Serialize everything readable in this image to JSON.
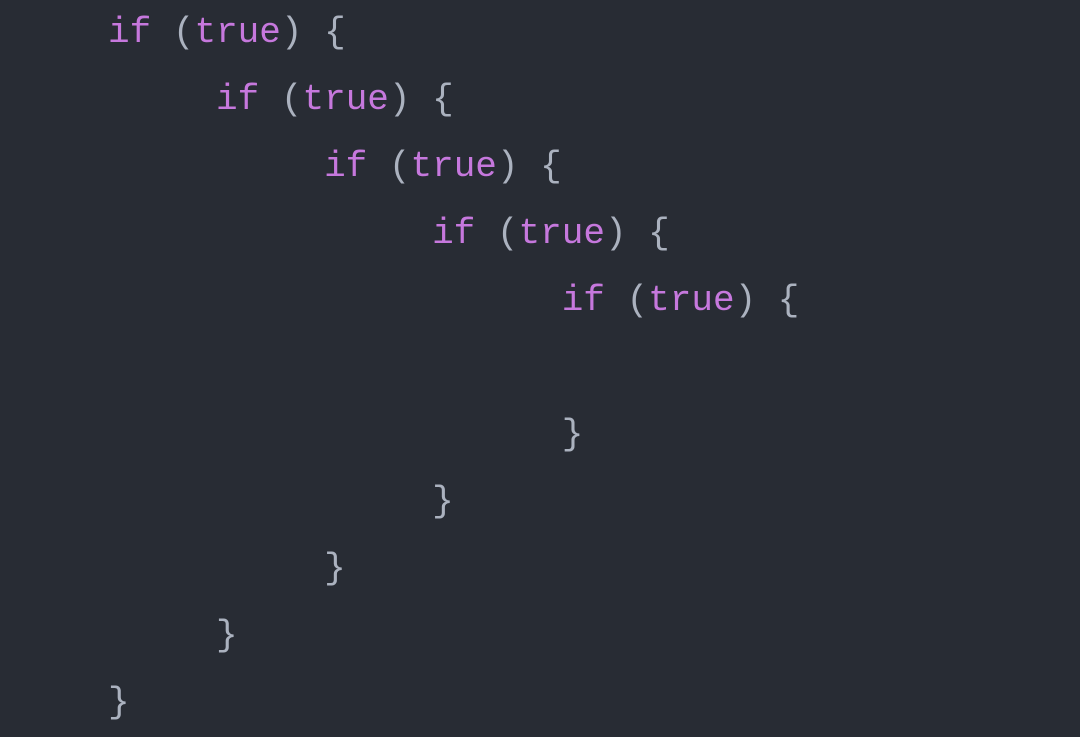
{
  "code": {
    "keyword": "if",
    "condition": "true",
    "open_paren": "(",
    "close_paren": ")",
    "open_brace": "{",
    "close_brace": "}",
    "space": " "
  },
  "lines": [
    {
      "indent": 0,
      "type": "if_open"
    },
    {
      "indent": 1,
      "type": "if_open"
    },
    {
      "indent": 2,
      "type": "if_open"
    },
    {
      "indent": 3,
      "type": "if_open"
    },
    {
      "indent": 4,
      "type": "if_open"
    },
    {
      "indent": 5,
      "type": "blank"
    },
    {
      "indent": 4,
      "type": "close"
    },
    {
      "indent": 3,
      "type": "close"
    },
    {
      "indent": 2,
      "type": "close"
    },
    {
      "indent": 1,
      "type": "close"
    },
    {
      "indent": 0,
      "type": "close"
    }
  ],
  "colors": {
    "background": "#282c34",
    "keyword": "#c678dd",
    "boolean": "#c678dd",
    "punctuation": "#abb2bf",
    "default": "#abb2bf"
  }
}
